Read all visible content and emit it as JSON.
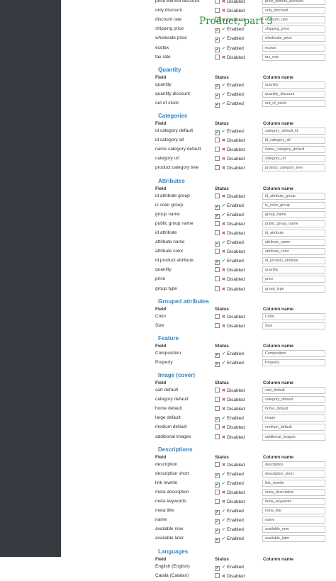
{
  "overlay_title": "Product, part 3",
  "col_headers": {
    "field": "Field",
    "status": "Status",
    "column": "Column name"
  },
  "status_labels": {
    "enabled": "Enabled",
    "disabled": "Disabled"
  },
  "colors": {
    "sidebar": "#363a41",
    "section_heading": "#2f86c6",
    "enabled": "#56a54a",
    "disabled": "#d9534f",
    "overlay": "#2e8b3a"
  },
  "sections": [
    {
      "title": "",
      "rows": [
        {
          "field": "price without discount",
          "enabled": false,
          "column": "price_without_discount"
        },
        {
          "field": "only discount",
          "enabled": false,
          "column": "only_discount"
        },
        {
          "field": "discount rate",
          "enabled": false,
          "column": "discount_rate"
        },
        {
          "field": "shipping price",
          "enabled": true,
          "column": "shipping_price"
        },
        {
          "field": "wholesale price",
          "enabled": true,
          "column": "wholesale_price"
        },
        {
          "field": "ecotax",
          "enabled": true,
          "column": "ecotax"
        },
        {
          "field": "tax rate",
          "enabled": false,
          "column": "tax_rate"
        }
      ]
    },
    {
      "title": "Quantity",
      "rows": [
        {
          "field": "quantity",
          "enabled": true,
          "column": "quantity"
        },
        {
          "field": "quantity discount",
          "enabled": true,
          "column": "quantity_discount"
        },
        {
          "field": "out of stock",
          "enabled": true,
          "column": "out_of_stock"
        }
      ]
    },
    {
      "title": "Categories",
      "rows": [
        {
          "field": "id category default",
          "enabled": true,
          "column": "category_default_id"
        },
        {
          "field": "id category all",
          "enabled": false,
          "column": "id_category_all"
        },
        {
          "field": "name category default",
          "enabled": false,
          "column": "name_category_default"
        },
        {
          "field": "category url",
          "enabled": false,
          "column": "category_url"
        },
        {
          "field": "product category tree",
          "enabled": false,
          "column": "product_category_tree"
        }
      ]
    },
    {
      "title": "Attributes",
      "rows": [
        {
          "field": "id attribute group",
          "enabled": false,
          "column": "id_attribute_group"
        },
        {
          "field": "is color group",
          "enabled": true,
          "column": "is_color_group"
        },
        {
          "field": "group name",
          "enabled": true,
          "column": "group_name"
        },
        {
          "field": "public group name",
          "enabled": false,
          "column": "public_group_name"
        },
        {
          "field": "id attribute",
          "enabled": false,
          "column": "id_attribute"
        },
        {
          "field": "attribute name",
          "enabled": true,
          "column": "attribute_name"
        },
        {
          "field": "attribute color",
          "enabled": false,
          "column": "attribute_color"
        },
        {
          "field": "id product attribute",
          "enabled": true,
          "column": "id_product_attribute"
        },
        {
          "field": "quantity",
          "enabled": false,
          "column": "quantity"
        },
        {
          "field": "price",
          "enabled": false,
          "column": "price"
        },
        {
          "field": "group type",
          "enabled": false,
          "column": "group_type"
        }
      ]
    },
    {
      "title": "Grouped attributes",
      "rows": [
        {
          "field": "Color",
          "enabled": false,
          "column": "Color"
        },
        {
          "field": "Size",
          "enabled": false,
          "column": "Size"
        }
      ]
    },
    {
      "title": "Feature",
      "rows": [
        {
          "field": "Composition",
          "enabled": true,
          "column": "Composition"
        },
        {
          "field": "Property",
          "enabled": true,
          "column": "Property"
        }
      ]
    },
    {
      "title": "Image (cover)",
      "rows": [
        {
          "field": "cart default",
          "enabled": false,
          "column": "cart_default"
        },
        {
          "field": "category default",
          "enabled": false,
          "column": "category_default"
        },
        {
          "field": "home default",
          "enabled": false,
          "column": "home_default"
        },
        {
          "field": "large default",
          "enabled": true,
          "column": "image"
        },
        {
          "field": "medium default",
          "enabled": false,
          "column": "medium_default"
        },
        {
          "field": "additional images",
          "enabled": false,
          "column": "additional_images"
        }
      ]
    },
    {
      "title": "Descriptions",
      "rows": [
        {
          "field": "description",
          "enabled": false,
          "column": "description"
        },
        {
          "field": "description short",
          "enabled": true,
          "column": "description_short"
        },
        {
          "field": "link rewrite",
          "enabled": true,
          "column": "link_rewrite"
        },
        {
          "field": "meta description",
          "enabled": false,
          "column": "meta_description"
        },
        {
          "field": "meta keywords",
          "enabled": false,
          "column": "meta_keywords"
        },
        {
          "field": "meta title",
          "enabled": true,
          "column": "meta_title"
        },
        {
          "field": "name",
          "enabled": true,
          "column": "name"
        },
        {
          "field": "available now",
          "enabled": true,
          "column": "available_now"
        },
        {
          "field": "available later",
          "enabled": true,
          "column": "available_later"
        }
      ]
    },
    {
      "title": "Languages",
      "rows": [
        {
          "field": "English (English)",
          "enabled": true,
          "column": ""
        },
        {
          "field": "Català (Catalan)",
          "enabled": false,
          "column": ""
        }
      ]
    }
  ]
}
